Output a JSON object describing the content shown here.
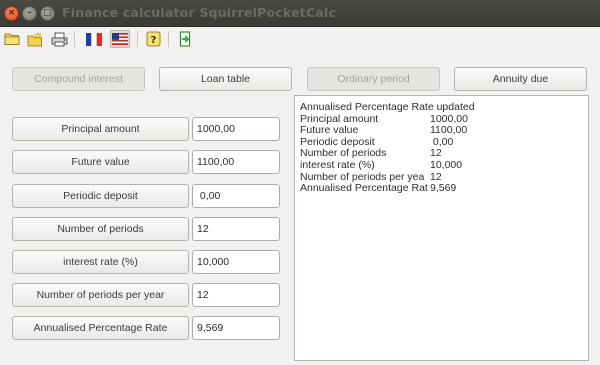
{
  "window": {
    "title": "Finance calculator SquirrelPocketCalc",
    "close_glyph": "×",
    "minimize_glyph": "–",
    "maximize_glyph": "□"
  },
  "toolbar": {
    "icons": [
      "open-folder-icon",
      "new-folder-icon",
      "print-icon",
      "french-flag-icon",
      "us-flag-icon",
      "help-icon",
      "exit-icon"
    ],
    "active": "us-flag-icon"
  },
  "modes": {
    "compound_interest": "Compound interest",
    "loan_table": "Loan table",
    "ordinary_period": "Ordinary period",
    "annuity_due": "Annuity due"
  },
  "fields": [
    {
      "label": "Principal amount",
      "value": "1000,00"
    },
    {
      "label": "Future value",
      "value": "1100,00"
    },
    {
      "label": "Periodic deposit",
      "value": " 0,00"
    },
    {
      "label": "Number of periods",
      "value": "12"
    },
    {
      "label": "interest rate (%)",
      "value": "10,000"
    },
    {
      "label": "Number of periods per year",
      "value": "12"
    },
    {
      "label": "Annualised Percentage Rate",
      "value": "9,569"
    }
  ],
  "output": {
    "heading": "Annualised Percentage Rate updated",
    "rows": [
      {
        "label": "Principal amount",
        "value": "1000,00"
      },
      {
        "label": "Future value",
        "value": "1100,00"
      },
      {
        "label": "Periodic deposit",
        "value": " 0,00"
      },
      {
        "label": "Number of periods",
        "value": "12"
      },
      {
        "label": "interest rate (%)",
        "value": "10,000"
      },
      {
        "label": "Number of periods per yea",
        "value": "12"
      },
      {
        "label": "Annualised Percentage Rat",
        "value": "9,569"
      }
    ]
  },
  "colors": {
    "titlebar": "#3c3b37",
    "title_text": "#6d6b63",
    "window_bg": "#f2f1f0",
    "close_button": "#e95420"
  }
}
